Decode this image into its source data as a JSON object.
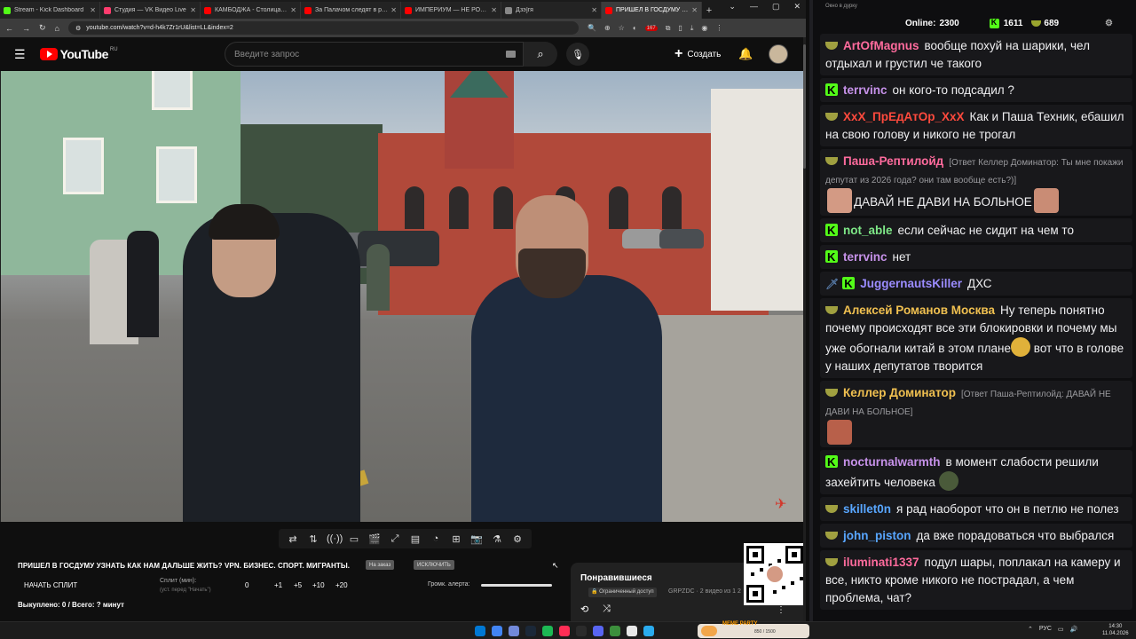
{
  "browser": {
    "tabs": [
      {
        "label": "Stream - Kick Dashboard",
        "color": "#53fc18",
        "active": false
      },
      {
        "label": "Студия — VK Видео Live",
        "color": "#ff3c6e",
        "active": false
      },
      {
        "label": "КАМБОДЖА - Столица Ми",
        "color": "#ff0000",
        "active": false
      },
      {
        "label": "За Палачом следят в реал",
        "color": "#ff0000",
        "active": false
      },
      {
        "label": "ИМПЕРИУМ — НЕ РОССИЯ",
        "color": "#ff0000",
        "active": false
      },
      {
        "label": "Дзэ]гя",
        "color": "#888888",
        "active": false
      },
      {
        "label": "ПРИШЕЛ В ГОСДУМУ УЗНА",
        "color": "#ff0000",
        "active": true
      }
    ],
    "url": "youtube.com/watch?v=d-h4k7Zr1rU&list=LL&index=2",
    "ext_badge": "167"
  },
  "youtube": {
    "logo_text": "YouTube",
    "region": "RU",
    "search_placeholder": "Введите запрос",
    "create_label": "Создать"
  },
  "player_controls": [
    "loop-icon",
    "sort-icon",
    "broadcast-icon",
    "cast-icon",
    "clapper-icon",
    "frame-icon",
    "film-icon",
    "speed-icon",
    "add-icon",
    "screenshot-icon",
    "lab-icon",
    "settings-icon"
  ],
  "player_control_glyphs": [
    "⇄",
    "⇅",
    "((·))",
    "▭",
    "🎬",
    "⤢",
    "▤",
    "◔",
    "⊞",
    "📷",
    "⚗",
    "⚙"
  ],
  "below": {
    "title": "ПРИШЕЛ В ГОСДУМУ УЗНАТЬ КАК НАМ ДАЛЬШЕ ЖИТЬ? VPN. БИЗНЕС. СПОРТ. МИГРАНТЫ.",
    "pill1": "На заказ",
    "pill2": "ИСКЛЮЧИТЬ",
    "split_button": "НАЧАТЬ СПЛИТ",
    "split_label": "Сплит (мин):",
    "split_sub": "(уст. перед \"Начать\")",
    "steps": [
      "0",
      "+1",
      "+5",
      "+10",
      "+20"
    ],
    "volume_label": "Громк. алерта:",
    "paid_line": "Выкуплено: 0 / Всего: ? минут"
  },
  "liked": {
    "title": "Понравившиеся",
    "access": "Ограниченный доступ",
    "meta": "GRPZDC · 2 видео из 1 2"
  },
  "chat": {
    "window_title": "Окно в дурку",
    "online_label": "Online:",
    "online_count": "2300",
    "kick_count": "1611",
    "other_count": "689",
    "messages": [
      {
        "badge": "dish",
        "user": "ArtOfMagnus",
        "color": "#ff6b9d",
        "text": "вообще похуй на шарики, чел отдыхал и грустил че такого"
      },
      {
        "badge": "k",
        "user": "terrvinc",
        "color": "#c792ea",
        "text": "он кого-то подсадил ?"
      },
      {
        "badge": "dish",
        "user": "XxX_ПрЕдАтОр_XxX",
        "color": "#ff4a3d",
        "text": "Как и Паша Техник, ебашил на свою голову и никого не трогал"
      },
      {
        "badge": "dish",
        "user": "Паша-Рептилойд",
        "color": "#ff6b9d",
        "reply": "[Ответ Келлер Доминатор: Ты мне покажи депутат из 2026 года? они там вообще есть?)]",
        "text": "ДАВАЙ НЕ ДАВИ НА БОЛЬНОЕ"
      },
      {
        "badge": "k",
        "user": "not_able",
        "color": "#7ee787",
        "text": "если сейчас не сидит на чем то"
      },
      {
        "badge": "k",
        "user": "terrvinc",
        "color": "#c792ea",
        "text": "нет"
      },
      {
        "badge": "sword-k",
        "user": "JuggernautsKiller",
        "color": "#9b8cff",
        "text": "ДХС"
      },
      {
        "badge": "dish",
        "user": "Алексей Романов Москва",
        "color": "#f0c050",
        "text": "Ну теперь понятно почему происходят все эти блокировки и почему мы уже обогнали китай в этом плане",
        "text2": "вот что в голове у наших депутатов творится"
      },
      {
        "badge": "dish",
        "user": "Келлер Доминатор",
        "color": "#f0c050",
        "reply": "[Ответ Паша-Рептилойд: ДАВАЙ НЕ ДАВИ НА БОЛЬНОЕ]",
        "text": ""
      },
      {
        "badge": "k",
        "user": "nocturnalwarmth",
        "color": "#c792ea",
        "text": "в момент слабости решили захейтить человека"
      },
      {
        "badge": "dish",
        "user": "skillet0n",
        "color": "#58a6ff",
        "text": "я рад наоборот что он в петлю не полез"
      },
      {
        "badge": "dish",
        "user": "john_piston",
        "color": "#58a6ff",
        "text": "да вже порадоваться что выбрался"
      },
      {
        "badge": "dish",
        "user": "iluminati1337",
        "color": "#ff6b9d",
        "text": "подул шары, поплакал на камеру и все, никто кроме никого не пострадал, а чем проблема, чат?"
      }
    ]
  },
  "taskbar": {
    "widget_label": "MEME PARTY",
    "widget_value": "850 / 1500",
    "lang": "РУС",
    "time": "14:30",
    "date": "11.04.2026"
  }
}
